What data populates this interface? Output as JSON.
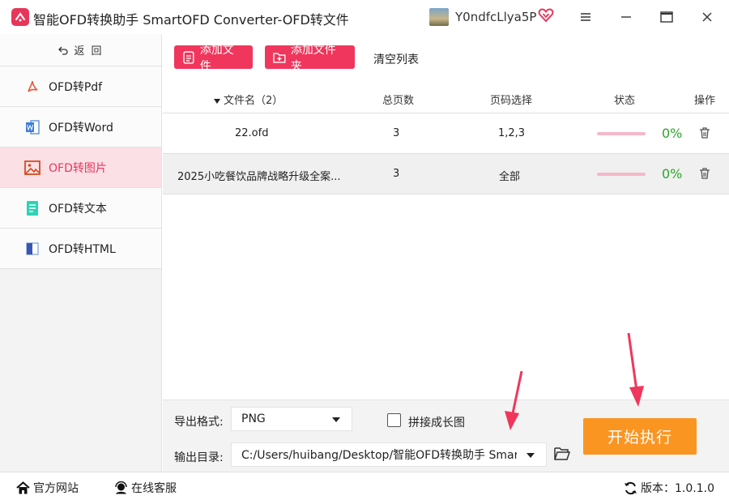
{
  "window": {
    "title": "智能OFD转换助手 SmartOFD Converter-OFD转文件",
    "user_name": "Y0ndfcLlya5P"
  },
  "sidebar": {
    "back_label": "返 回",
    "items": [
      {
        "label": "OFD转Pdf",
        "icon": "pdf-icon"
      },
      {
        "label": "OFD转Word",
        "icon": "word-icon"
      },
      {
        "label": "OFD转图片",
        "icon": "image-icon",
        "active": true
      },
      {
        "label": "OFD转文本",
        "icon": "text-icon"
      },
      {
        "label": "OFD转HTML",
        "icon": "html-icon"
      }
    ]
  },
  "toolbar": {
    "add_file": "添加文件",
    "add_folder": "添加文件夹",
    "clear_list": "清空列表"
  },
  "table": {
    "headers": {
      "name": "文件名（2）",
      "pages": "总页数",
      "range": "页码选择",
      "status": "状态",
      "action": "操作"
    },
    "rows": [
      {
        "name": "22.ofd",
        "pages": "3",
        "range": "1,2,3",
        "percent": "0%",
        "progress": 0
      },
      {
        "name": "2025小吃餐饮品牌战略升级全案...",
        "pages": "3",
        "range": "全部",
        "percent": "0%",
        "progress": 0
      }
    ]
  },
  "settings": {
    "format_label": "导出格式:",
    "format_value": "PNG",
    "stitch_label": "拼接成长图",
    "output_label": "输出目录:",
    "output_value": "C:/Users/huibang/Desktop/智能OFD转换助手 Smart",
    "start_label": "开始执行"
  },
  "statusbar": {
    "website": "官方网站",
    "support": "在线客服",
    "version": "版本：1.0.1.0"
  },
  "colors": {
    "accent": "#f0365c",
    "start": "#fb9522",
    "ok": "#2aa52a",
    "arrow": "#f0365c"
  }
}
